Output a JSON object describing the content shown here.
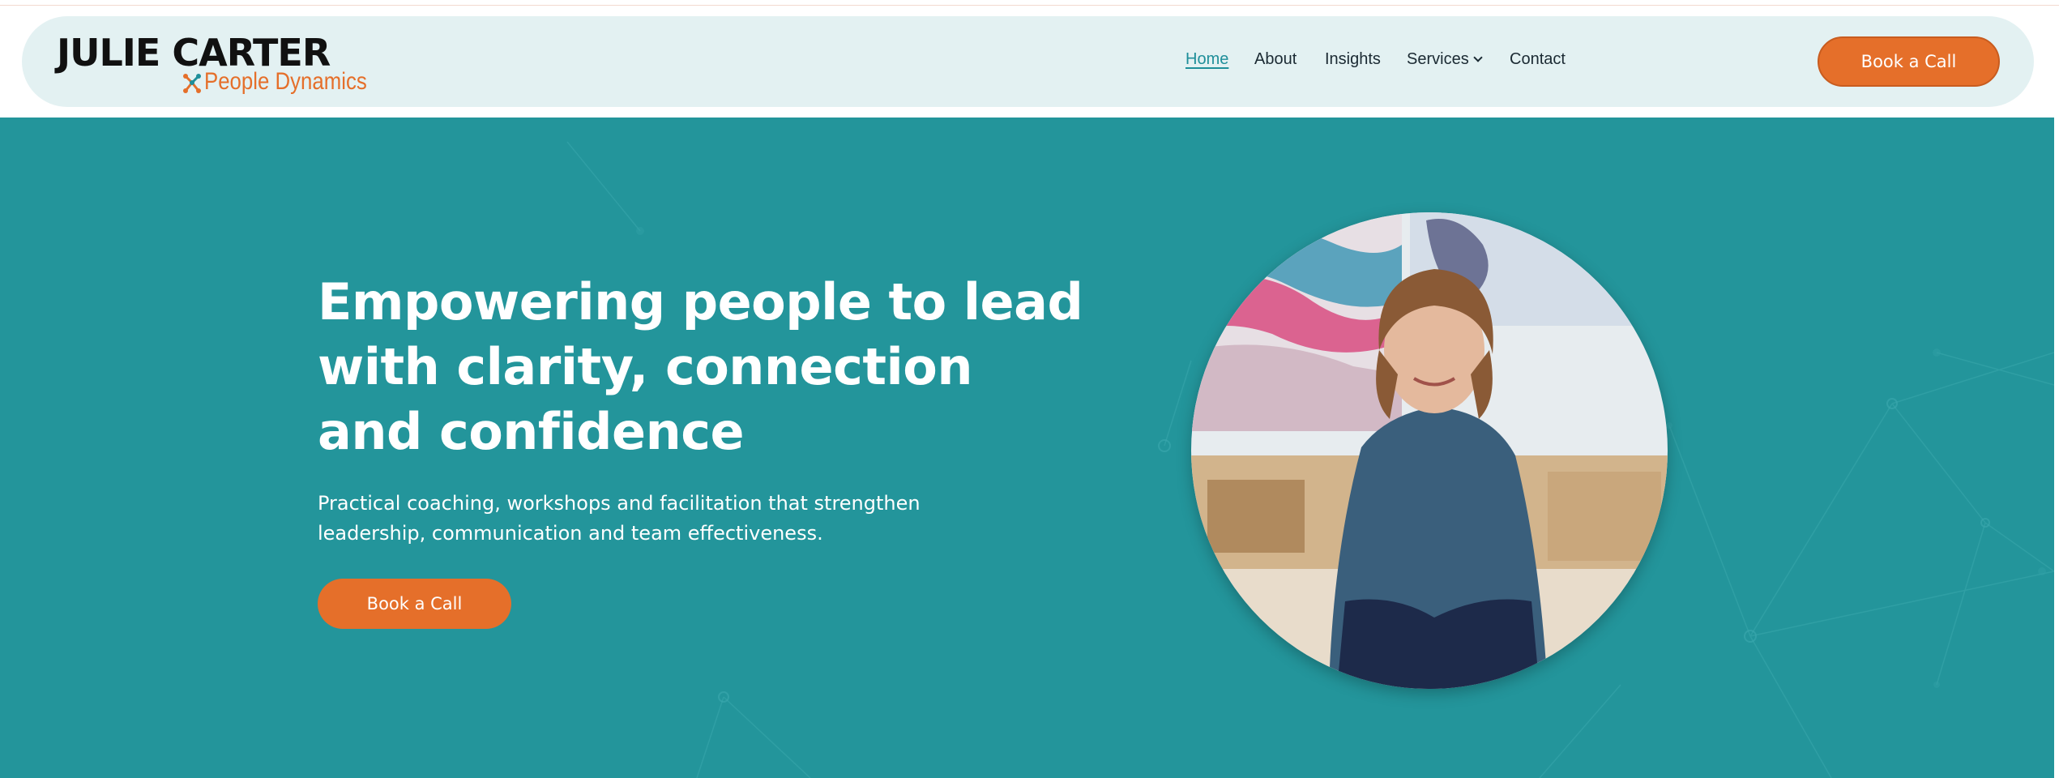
{
  "brand": {
    "name": "JULIE CARTER",
    "tagline": "People Dynamics"
  },
  "nav": {
    "items": [
      {
        "label": "Home",
        "active": true
      },
      {
        "label": "About"
      },
      {
        "label": "Insights"
      },
      {
        "label": "Services",
        "has_dropdown": true
      },
      {
        "label": "Contact"
      }
    ],
    "cta_label": "Book a Call"
  },
  "hero": {
    "title": "Empowering people to lead with clarity, connection and confidence",
    "subtitle": "Practical coaching, workshops and facilitation that strengthen leadership, communication and team effectiveness.",
    "cta_label": "Book a Call",
    "image_icon": "portrait-photo"
  },
  "colors": {
    "accent_orange": "#e56f2a",
    "hero_teal": "#23959b",
    "nav_pill": "#e3f1f2",
    "link_active": "#1f8f9a"
  }
}
